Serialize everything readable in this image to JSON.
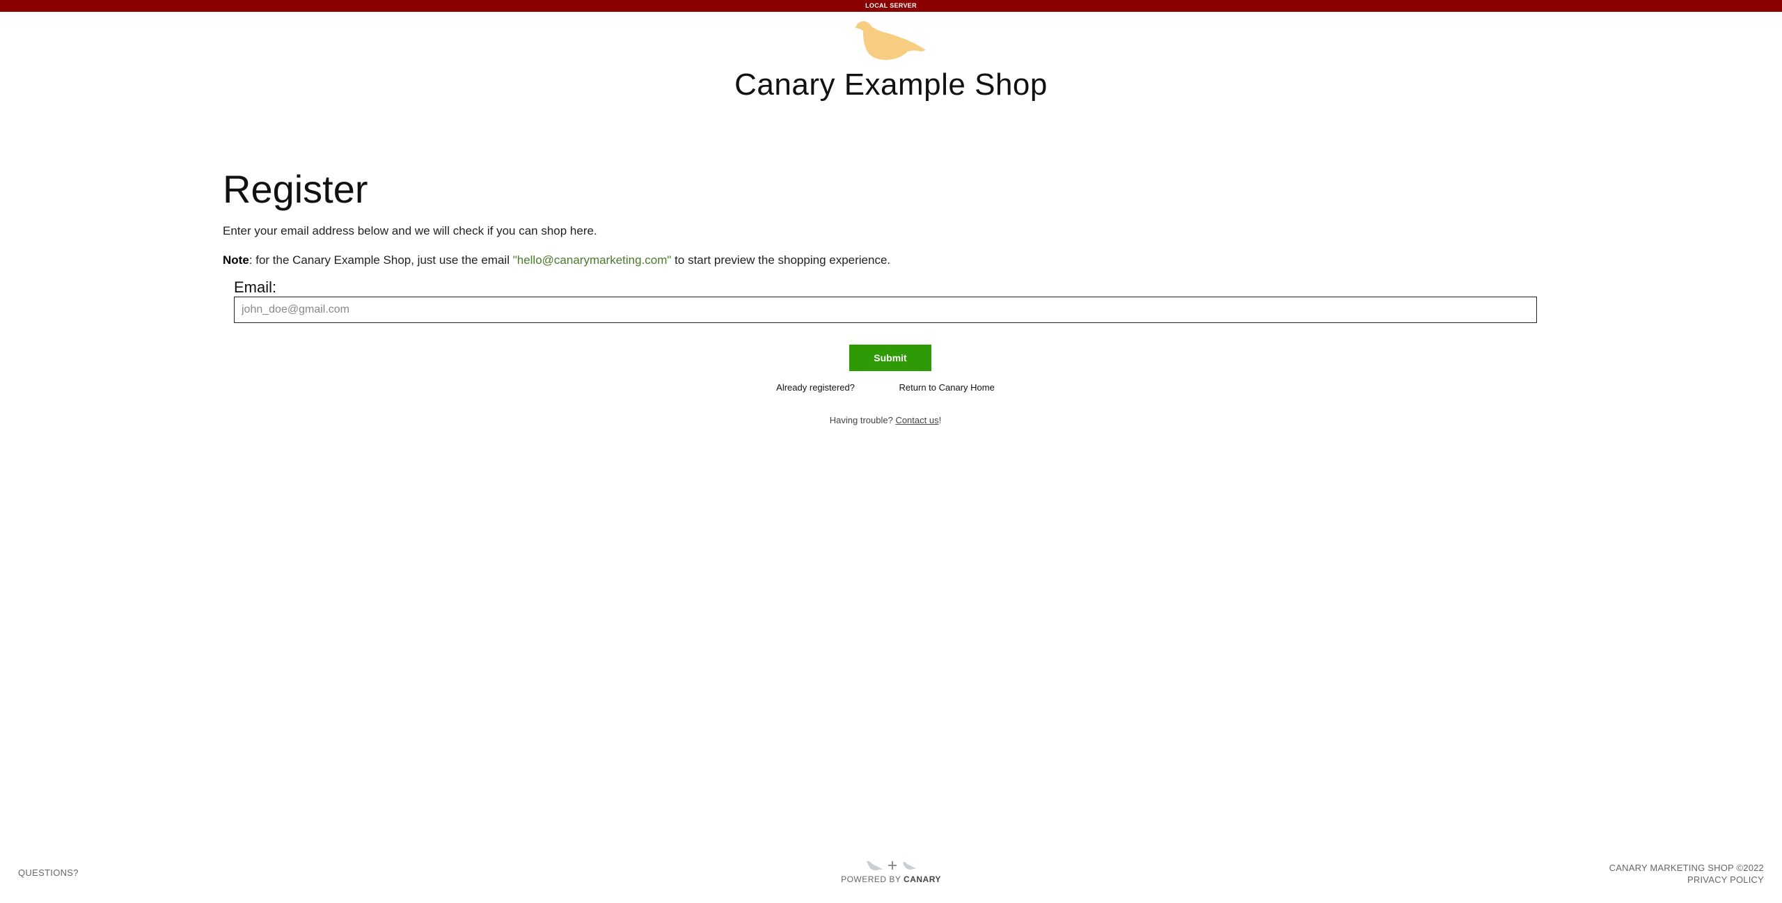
{
  "topbar": {
    "label": "LOCAL SERVER",
    "color": "#8b0000"
  },
  "header": {
    "title": "Canary Example Shop",
    "logo_icon": "canary-bird-icon",
    "logo_color": "#f7cd81"
  },
  "register": {
    "heading": "Register",
    "intro": "Enter your email address below and we will check if you can shop here.",
    "note_label": "Note",
    "note_before": ": for the Canary Example Shop, just use the email ",
    "note_email": "\"hello@canarymarketing.com\"",
    "note_after": " to start preview the shopping experience.",
    "email_label": "Email:",
    "email_placeholder": "john_doe@gmail.com",
    "email_value": "",
    "submit_label": "Submit",
    "submit_color": "#2e9a06"
  },
  "links": {
    "already_registered": "Already registered?",
    "return_home": "Return to Canary Home"
  },
  "help": {
    "prefix": "Having trouble? ",
    "contact_link": "Contact us",
    "suffix": "!"
  },
  "footer": {
    "questions": "QUESTIONS?",
    "powered_by": "POWERED BY ",
    "powered_brand": "CANARY",
    "copyright": "CANARY MARKETING SHOP ©2022",
    "privacy": "PRIVACY POLICY"
  }
}
